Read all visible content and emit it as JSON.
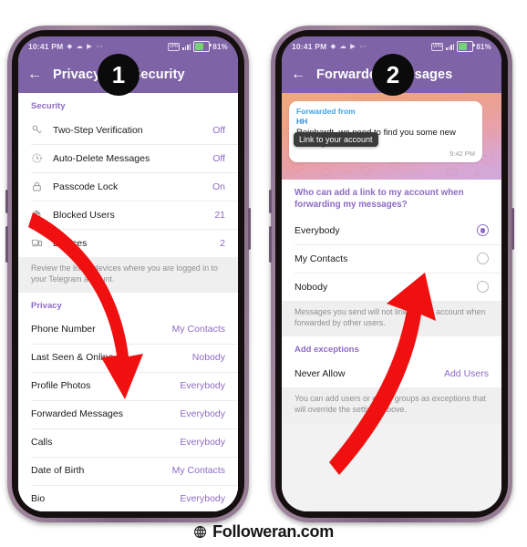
{
  "footer": {
    "brand": "Followeran.com",
    "globe_icon": "globe-icon"
  },
  "annotations": {
    "badge_one": "1",
    "badge_two": "2",
    "arrow_color": "#f01010"
  },
  "theme": {
    "header_purple": "#7e64a6",
    "accent_purple": "#8e6bc4",
    "link_blue": "#3fa2e8",
    "battery_green": "#77d17b",
    "frame_purple": "#8d7392"
  },
  "phone1": {
    "statusbar": {
      "time": "10:41 PM",
      "icons": [
        "chat-icon",
        "cloud-icon",
        "play-icon",
        "more-icon"
      ],
      "vpn_label": "VPN",
      "network_label": "4.5G",
      "battery_percent": "81%"
    },
    "appbar": {
      "back_icon": "back-arrow-icon",
      "title": "Privacy and Security"
    },
    "sections": [
      {
        "header": "Security",
        "rows": [
          {
            "icon": "key-icon",
            "label": "Two-Step Verification",
            "value": "Off"
          },
          {
            "icon": "timer-icon",
            "label": "Auto-Delete Messages",
            "value": "Off"
          },
          {
            "icon": "lock-icon",
            "label": "Passcode Lock",
            "value": "On"
          },
          {
            "icon": "hand-icon",
            "label": "Blocked Users",
            "value": "21"
          },
          {
            "icon": "devices-icon",
            "label": "Devices",
            "value": "2"
          }
        ],
        "caption": "Review the list of devices where you are logged in to your Telegram account."
      },
      {
        "header": "Privacy",
        "rows": [
          {
            "label": "Phone Number",
            "value": "My Contacts"
          },
          {
            "label": "Last Seen & Online",
            "value": "Nobody"
          },
          {
            "label": "Profile Photos",
            "value": "Everybody"
          },
          {
            "label": "Forwarded Messages",
            "value": "Everybody"
          },
          {
            "label": "Calls",
            "value": "Everybody"
          },
          {
            "label": "Date of Birth",
            "value": "My Contacts"
          },
          {
            "label": "Bio",
            "value": "Everybody"
          }
        ],
        "caption": ""
      }
    ]
  },
  "phone2": {
    "statusbar": {
      "time": "10:41 PM",
      "vpn_label": "VPN",
      "network_label": "4.5G",
      "battery_percent": "81%"
    },
    "appbar": {
      "back_icon": "back-arrow-icon",
      "title": "Forwarded Messages"
    },
    "chat_preview": {
      "forwarded_label": "Forwarded from",
      "forwarded_name": "HH",
      "message": "Reinhardt, we need to find you some new tunes ;).",
      "time": "9:42 PM",
      "tooltip": "Link to your account"
    },
    "question": "Who can add a link to my account when forwarding my messages?",
    "options": [
      {
        "label": "Everybody",
        "selected": true
      },
      {
        "label": "My Contacts",
        "selected": false
      },
      {
        "label": "Nobody",
        "selected": false
      }
    ],
    "options_caption": "Messages you send will not link to your account when forwarded by other users.",
    "exceptions_header": "Add exceptions",
    "exception_row": {
      "label": "Never Allow",
      "action": "Add Users"
    },
    "exceptions_caption": "You can add users or entire groups as exceptions that will override the settings above."
  }
}
